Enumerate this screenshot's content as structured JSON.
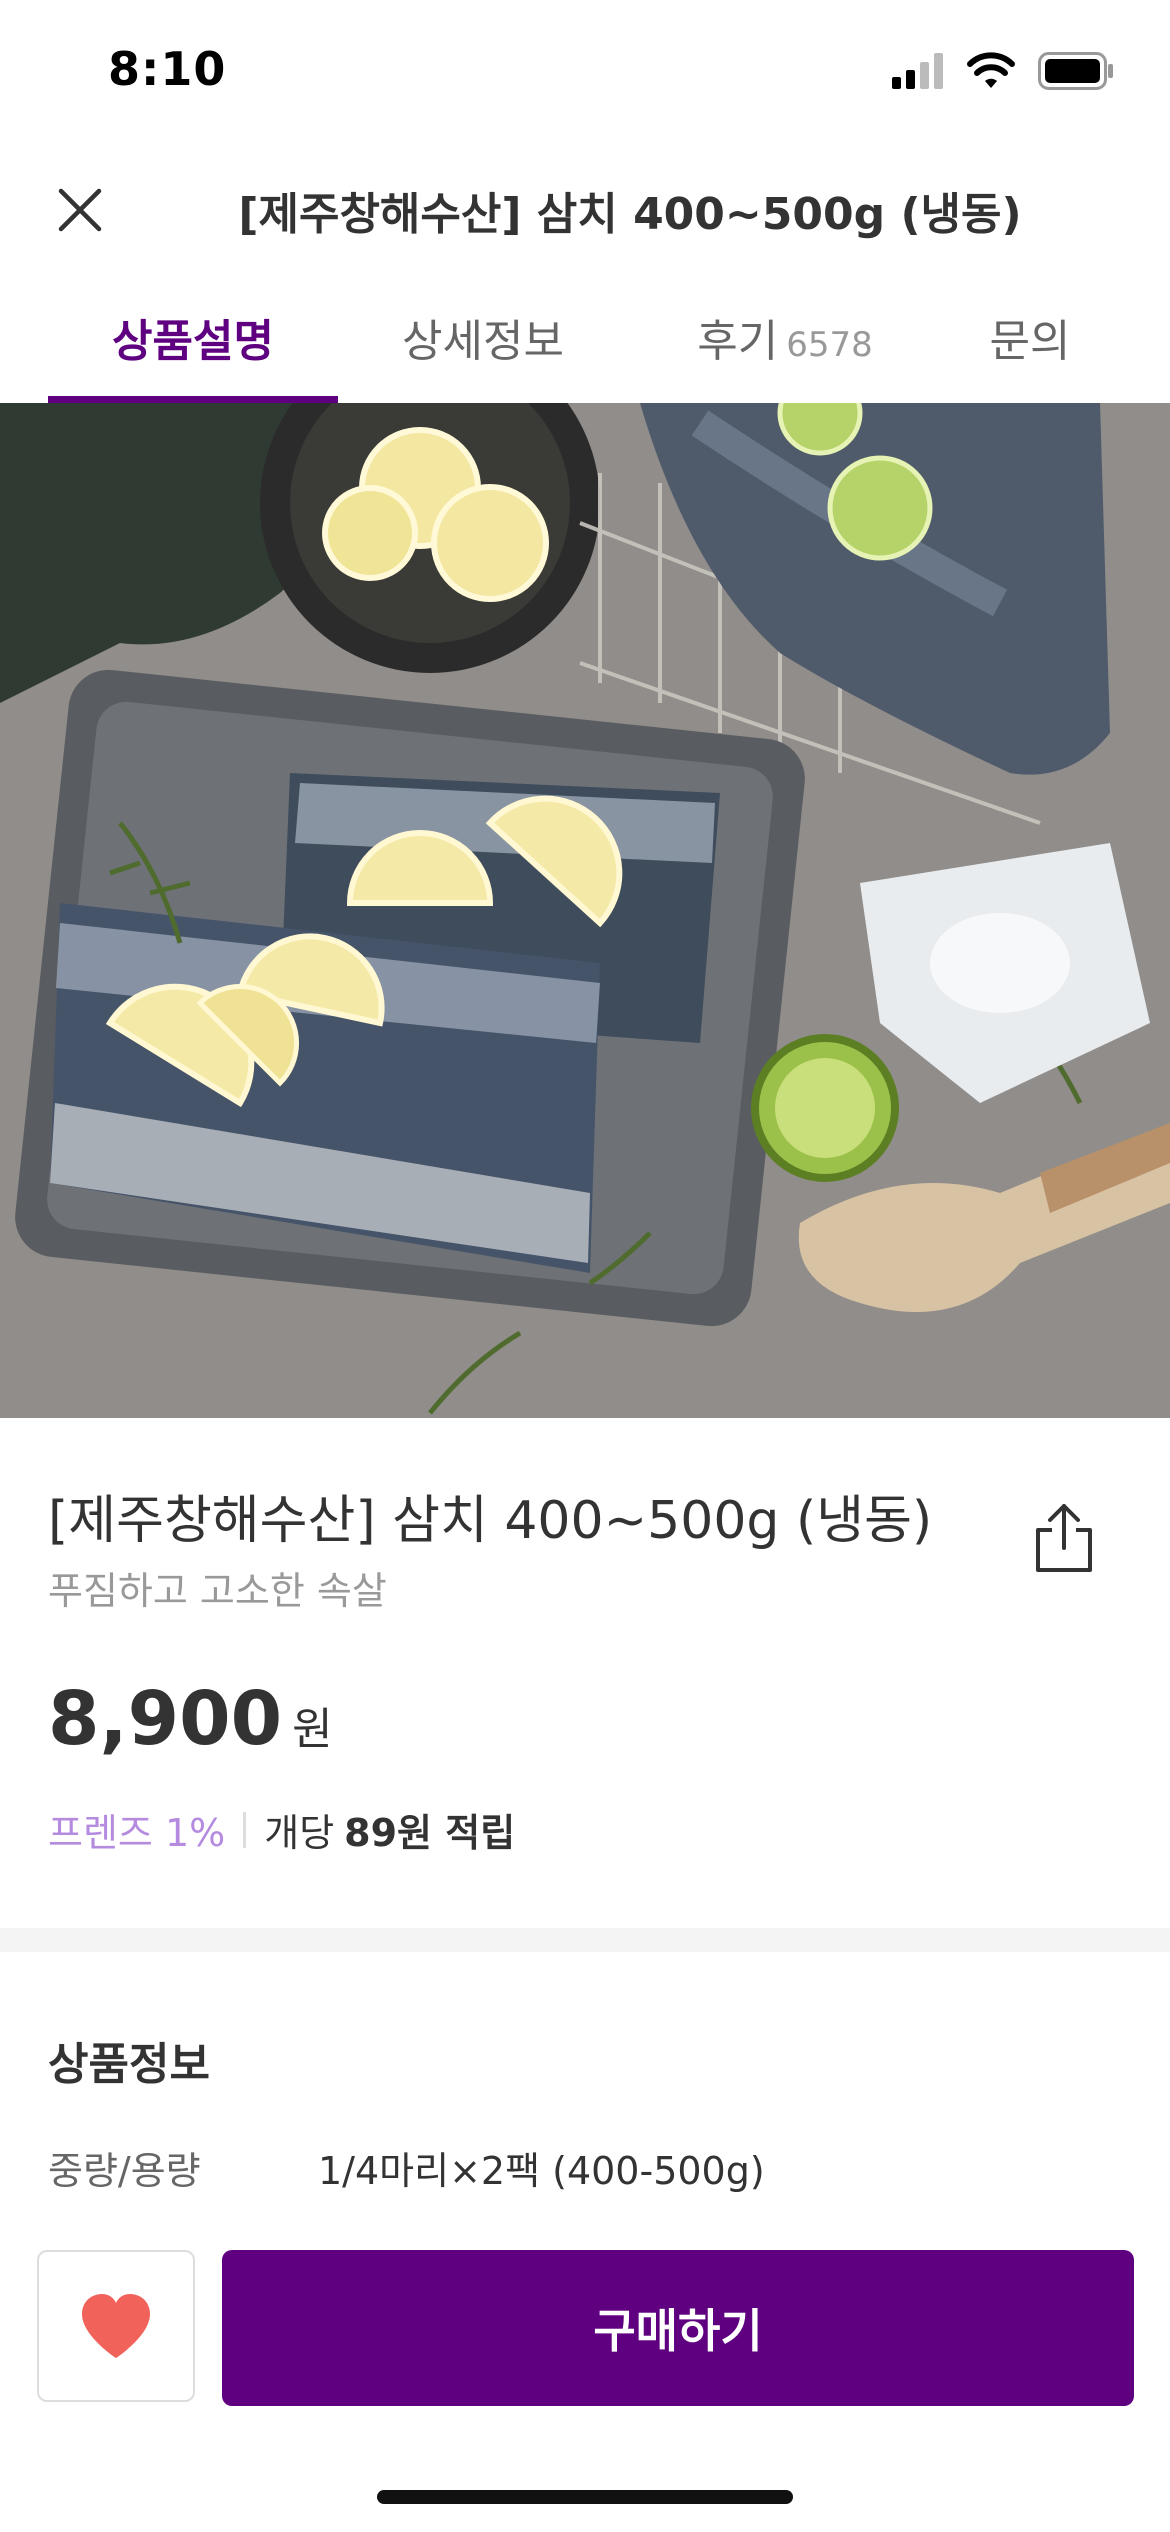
{
  "status_bar": {
    "time": "8:10"
  },
  "header": {
    "title": "[제주창해수산] 삼치 400~500g (냉동)"
  },
  "tabs": [
    {
      "label": "상품설명",
      "count": ""
    },
    {
      "label": "상세정보",
      "count": ""
    },
    {
      "label": "후기",
      "count": "6578"
    },
    {
      "label": "문의",
      "count": ""
    }
  ],
  "product": {
    "name": "[제주창해수산] 삼치 400~500g (냉동)",
    "subtitle": "푸짐하고 고소한 속살",
    "price": "8,900",
    "price_unit": "원",
    "points_grade": "프렌즈 1%",
    "points_prefix": "개당",
    "points_amount": "89원 적립"
  },
  "product_info": {
    "title": "상품정보",
    "rows": [
      {
        "label": "중량/용량",
        "value": "1/4마리×2팩 (400-500g)"
      }
    ]
  },
  "bottom_bar": {
    "buy_label": "구매하기"
  },
  "colors": {
    "accent": "#5f0080",
    "heart": "#f0625a",
    "points": "#b58be0"
  },
  "icons": [
    "close-icon",
    "share-icon",
    "heart-icon",
    "signal-icon",
    "wifi-icon",
    "battery-icon"
  ]
}
